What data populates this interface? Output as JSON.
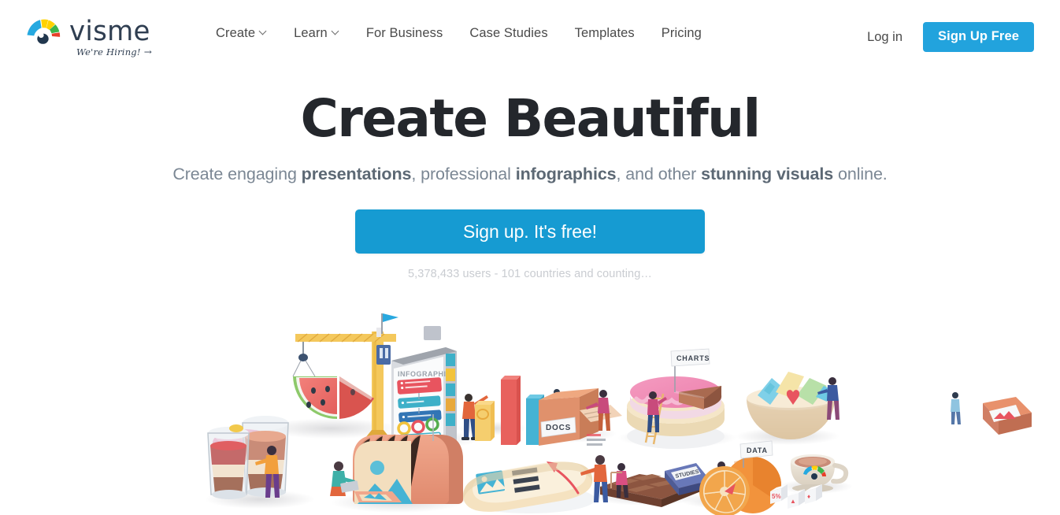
{
  "header": {
    "logo": {
      "icon": "visme-fan-logo-icon",
      "wordmark": "visme",
      "hiring_label": "We're Hiring!",
      "hiring_arrow": "→",
      "colors": {
        "blue": "#26A9E0",
        "yellow": "#FFD200",
        "green": "#3DB54A",
        "red": "#E8402A",
        "eye": "#21374E",
        "wordmark": "#2F3E51"
      }
    },
    "nav": [
      {
        "label": "Create",
        "has_dropdown": true
      },
      {
        "label": "Learn",
        "has_dropdown": true
      },
      {
        "label": "For Business",
        "has_dropdown": false
      },
      {
        "label": "Case Studies",
        "has_dropdown": false
      },
      {
        "label": "Templates",
        "has_dropdown": false
      },
      {
        "label": "Pricing",
        "has_dropdown": false
      }
    ],
    "login_label": "Log in",
    "signup_label": "Sign Up Free",
    "signup_color": "#22A3DD"
  },
  "hero": {
    "title": "Create Beautiful",
    "subtitle": {
      "part1": "Create engaging ",
      "bold1": "presentations",
      "part2": ", professional ",
      "bold2": "infographics",
      "part3": ", and other ",
      "bold3": "stunning visuals",
      "part4": " online."
    },
    "cta_label": "Sign up. It's free!",
    "cta_color": "#169BD2",
    "users_note": "5,378,433 users - 101 countries and counting…"
  },
  "illustration": {
    "name": "3d-food-data-visualization-scene",
    "labels": {
      "infographic": "INFOGRAPHIC",
      "graphics": "GRAPHICS",
      "docs": "DOCS",
      "charts": "CHARTS",
      "data": "DATA"
    }
  }
}
